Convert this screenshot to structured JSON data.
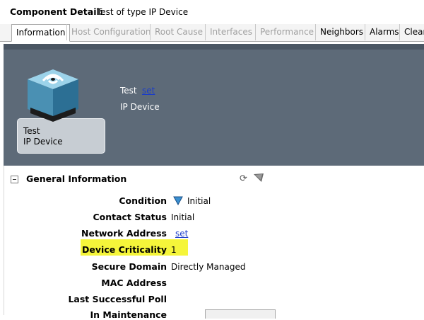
{
  "header": {
    "title_label": "Component Detail:",
    "title_value": "Test of type IP Device"
  },
  "tabs": [
    {
      "label": "Information",
      "state": "active"
    },
    {
      "label": "Host Configuration",
      "state": "disabled"
    },
    {
      "label": "Root Cause",
      "state": "disabled"
    },
    {
      "label": "Interfaces",
      "state": "disabled"
    },
    {
      "label": "Performance",
      "state": "disabled"
    },
    {
      "label": "Neighbors",
      "state": "enabled"
    },
    {
      "label": "Alarms",
      "state": "enabled"
    },
    {
      "label": "Clear",
      "state": "enabled"
    }
  ],
  "device": {
    "icon": "wireless-device-icon",
    "card_name": "Test",
    "card_type": "IP Device",
    "name": "Test",
    "set_link": "set",
    "type": "IP Device"
  },
  "general": {
    "title": "General Information",
    "rows": [
      {
        "label": "Condition",
        "value": "Initial",
        "icon": "triangle-down-icon"
      },
      {
        "label": "Contact Status",
        "value": "Initial"
      },
      {
        "label": "Network Address",
        "value": "set",
        "link": true
      },
      {
        "label": "Device Criticality",
        "value": "1",
        "highlight": true
      },
      {
        "label": "Secure Domain",
        "value": "Directly Managed"
      },
      {
        "label": "MAC Address",
        "value": ""
      },
      {
        "label": "Last Successful Poll",
        "value": ""
      },
      {
        "label": "In Maintenance",
        "value": ""
      }
    ]
  },
  "colors": {
    "banner": "#5d6a78",
    "highlight": "#f5f53a",
    "link": "#1a3cc9"
  }
}
